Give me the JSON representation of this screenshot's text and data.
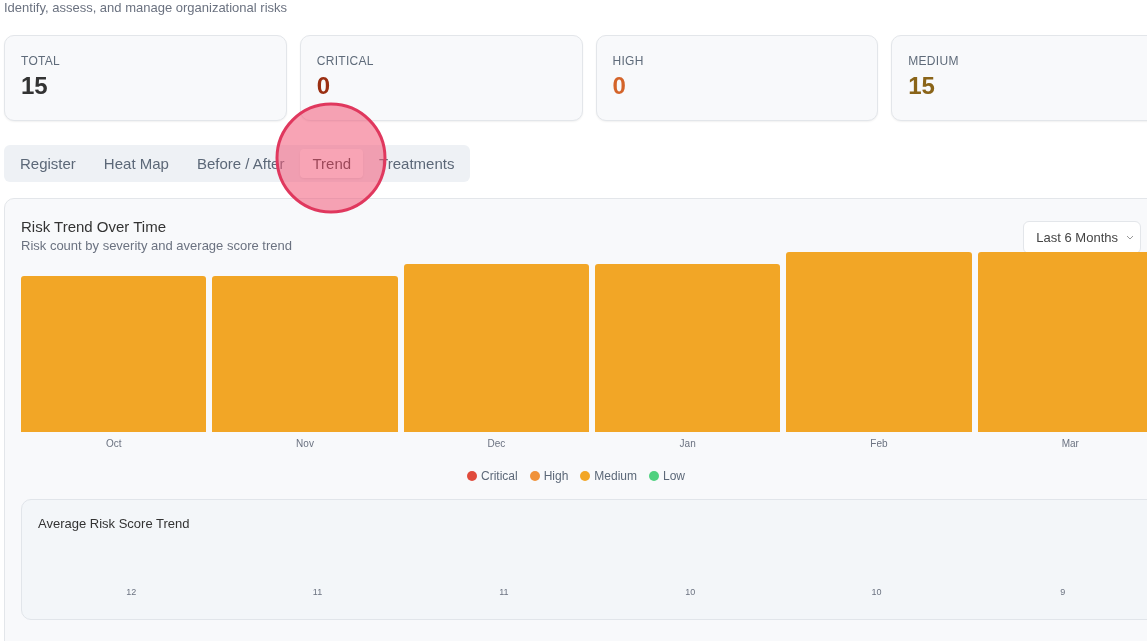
{
  "page": {
    "subtitle": "Identify, assess, and manage organizational risks"
  },
  "stats": [
    {
      "label": "TOTAL",
      "value": "15",
      "color": "#333333"
    },
    {
      "label": "CRITICAL",
      "value": "0",
      "color": "#9a2f12"
    },
    {
      "label": "HIGH",
      "value": "0",
      "color": "#d4642a"
    },
    {
      "label": "MEDIUM",
      "value": "15",
      "color": "#8a6418"
    }
  ],
  "tabs": [
    {
      "label": "Register",
      "selected": false
    },
    {
      "label": "Heat Map",
      "selected": false
    },
    {
      "label": "Before / After",
      "selected": false
    },
    {
      "label": "Trend",
      "selected": true
    },
    {
      "label": "Treatments",
      "selected": false
    }
  ],
  "trend_panel": {
    "title": "Risk Trend Over Time",
    "subtitle": "Risk count by severity and average score trend",
    "period": "Last 6 Months",
    "months": [
      "Oct",
      "Nov",
      "Dec",
      "Jan",
      "Feb",
      "Mar"
    ],
    "legend": [
      {
        "label": "Critical",
        "color": "#e04b3c"
      },
      {
        "label": "High",
        "color": "#f0923a"
      },
      {
        "label": "Medium",
        "color": "#f2a626"
      },
      {
        "label": "Low",
        "color": "#4fd17f"
      }
    ],
    "average_trend": {
      "title": "Average Risk Score Trend",
      "values": [
        "12",
        "11",
        "11",
        "10",
        "10",
        "9"
      ]
    }
  }
}
